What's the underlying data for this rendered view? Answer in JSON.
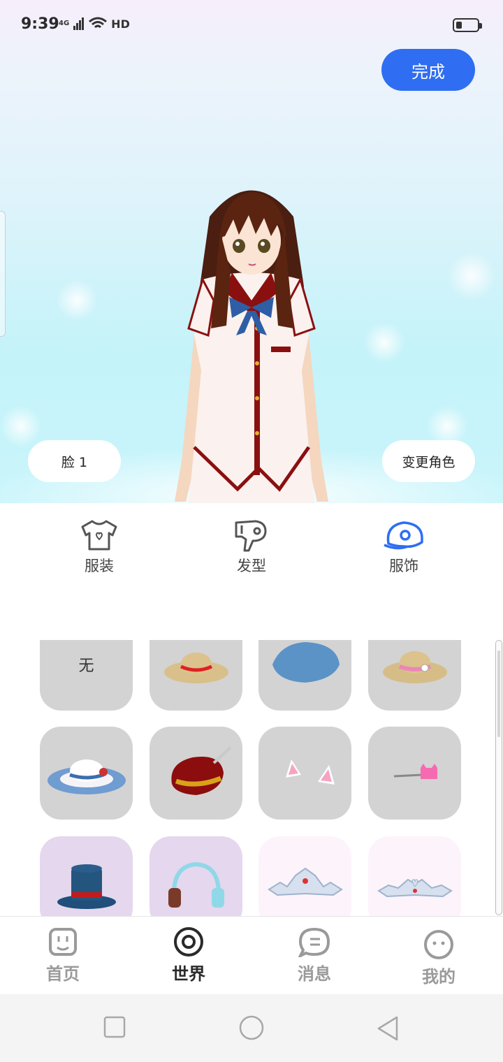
{
  "status_bar": {
    "time": "9:39",
    "network": "4G",
    "hd": "HD"
  },
  "header": {
    "done_label": "完成"
  },
  "scene": {
    "face_label": "脸 1",
    "change_character_label": "变更角色"
  },
  "categories": [
    {
      "label": "服装",
      "icon": "tshirt-icon",
      "active": false
    },
    {
      "label": "发型",
      "icon": "hair-dryer-icon",
      "active": false
    },
    {
      "label": "服饰",
      "icon": "cap-icon",
      "active": true
    }
  ],
  "items": {
    "none_label": "无",
    "list": [
      {
        "name": "none"
      },
      {
        "name": "straw-hat-red-band-icon"
      },
      {
        "name": "blue-beret-icon"
      },
      {
        "name": "straw-hat-pink-flower-icon"
      },
      {
        "name": "blue-sun-hat-icon"
      },
      {
        "name": "red-feather-hat-icon"
      },
      {
        "name": "cat-ears-icon"
      },
      {
        "name": "pink-cat-hairclip-icon"
      },
      {
        "name": "blue-top-hat-icon"
      },
      {
        "name": "headphones-icon"
      },
      {
        "name": "silver-tiara-icon"
      },
      {
        "name": "silver-heart-tiara-icon"
      }
    ]
  },
  "bottom_nav": [
    {
      "label": "首页",
      "icon": "home-face-icon",
      "active": false
    },
    {
      "label": "世界",
      "icon": "world-circle-icon",
      "active": true
    },
    {
      "label": "消息",
      "icon": "message-bubble-icon",
      "active": false
    },
    {
      "label": "我的",
      "icon": "profile-face-icon",
      "active": false
    }
  ],
  "colors": {
    "accent": "#2f6ef2",
    "active_tab": "#2f6ef2",
    "item_bg": "#d3d3d3"
  }
}
